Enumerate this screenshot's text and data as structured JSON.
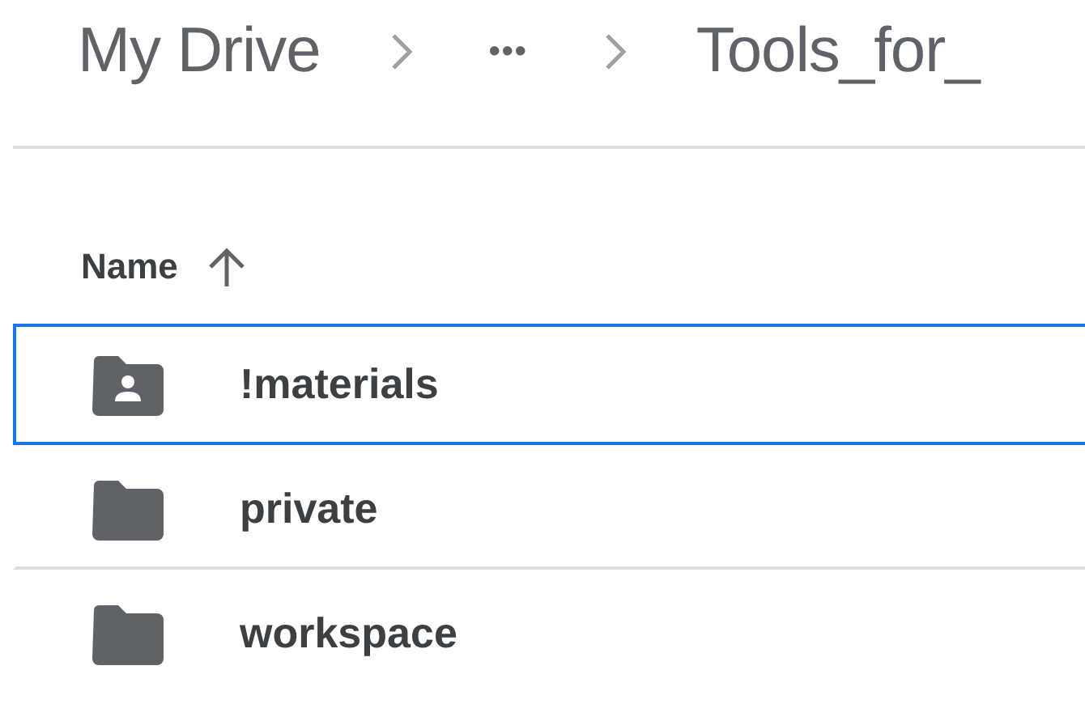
{
  "breadcrumb": [
    {
      "label": "My Drive",
      "kind": "link"
    },
    {
      "label": "•••",
      "kind": "more"
    },
    {
      "label": "Tools_for_",
      "kind": "link"
    }
  ],
  "header": {
    "label": "Name",
    "sorted_ascending": true
  },
  "rows": [
    {
      "name": "!materials",
      "kind": "shared-folder",
      "selected": true
    },
    {
      "name": "private",
      "kind": "folder",
      "selected": false
    },
    {
      "name": "workspace",
      "kind": "folder",
      "selected": false
    }
  ]
}
